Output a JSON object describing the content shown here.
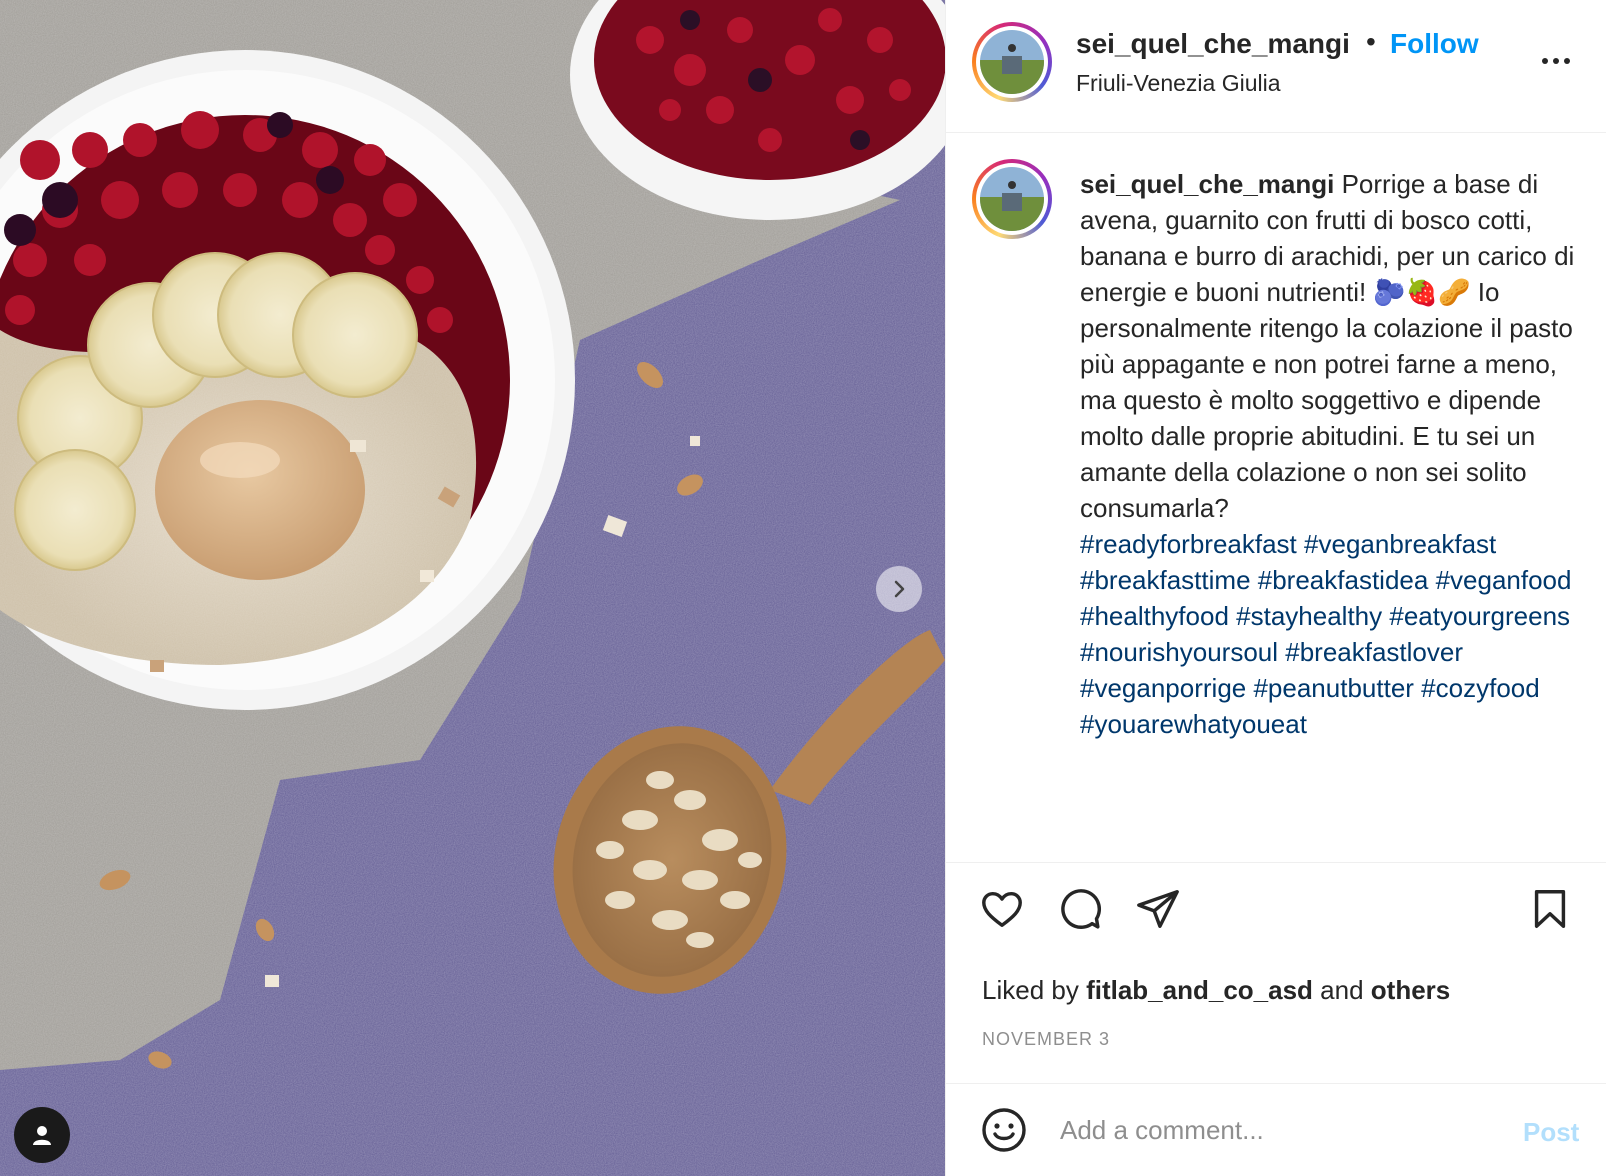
{
  "post": {
    "author": {
      "username": "sei_quel_che_mangi",
      "location": "Friuli-Venezia Giulia",
      "follow_label": "Follow",
      "separator": "•"
    },
    "caption": {
      "username": "sei_quel_che_mangi",
      "text": "Porrige a base di avena, guarnito con frutti di bosco cotti, banana e burro di arachidi, per un carico di energie e buoni nutrienti! 🫐🍓🥜 Io personalmente ritengo la colazione il pasto più appagante e non potrei farne a meno, ma questo è molto soggettivo e dipende molto dalle proprie abitudini. E tu sei un amante della colazione o non sei solito consumarla?",
      "hashtags": [
        "#readyforbreakfast",
        "#veganbreakfast",
        "#breakfasttime",
        "#breakfastidea",
        "#veganfood",
        "#healthyfood",
        "#stayhealthy",
        "#eatyourgreens",
        "#nourishyoursoul",
        "#breakfastlover",
        "#veganporrige",
        "#peanutbutter",
        "#cozyfood",
        "#youarewhatyoueat"
      ]
    },
    "likes": {
      "prefix": "Liked by",
      "user": "fitlab_and_co_asd",
      "conjunction": "and",
      "others": "others"
    },
    "date": "NOVEMBER 3"
  },
  "actions": {
    "like_icon": "heart-icon",
    "comment_icon": "comment-bubble-icon",
    "share_icon": "paper-plane-icon",
    "save_icon": "bookmark-icon"
  },
  "comment_box": {
    "placeholder": "Add a comment...",
    "post_label": "Post",
    "emoji_icon": "smiley-icon"
  },
  "media": {
    "next_icon": "chevron-right-icon",
    "tag_icon": "person-tag-icon"
  },
  "colors": {
    "link_blue": "#0095f6",
    "hashtag_blue": "#00376b",
    "muted": "#8e8e8e",
    "post_disabled": "#b2dffc"
  }
}
